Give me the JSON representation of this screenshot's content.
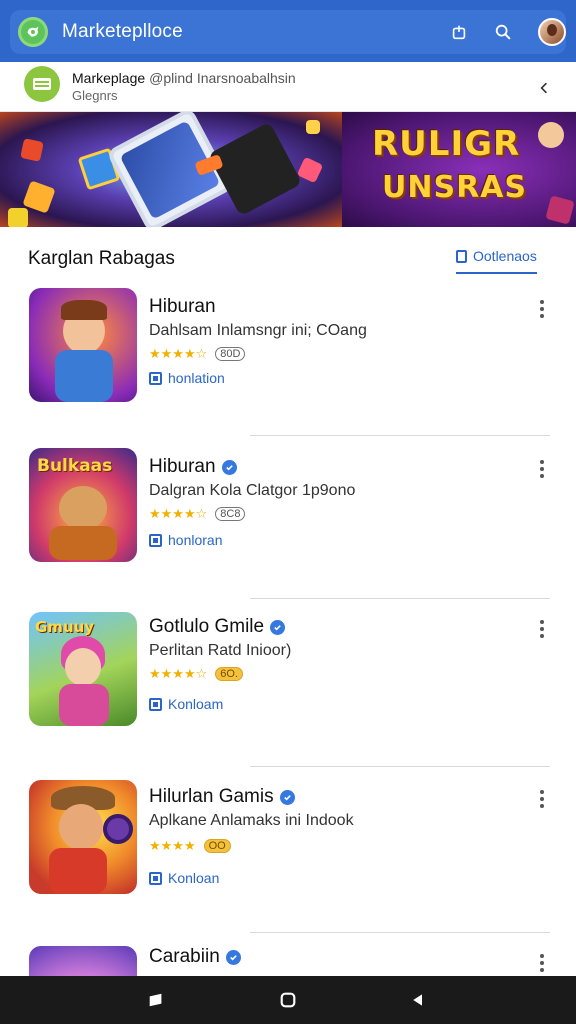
{
  "app_bar": {
    "title": "Marketeplloce",
    "icons": [
      "store-logo-icon",
      "share-icon",
      "search-icon",
      "user-avatar"
    ]
  },
  "header": {
    "title": "Markeplage",
    "title_extra": "@plind Inarsnoabalhsin",
    "subtitle": "Glegnrs"
  },
  "banner": {
    "headline_1": "RULIGR",
    "headline_2": "UNSRAS"
  },
  "section": {
    "title": "Karglan Rabagas",
    "link_label": "Ootlenaos"
  },
  "apps": [
    {
      "title": "Hiburan",
      "verified": false,
      "description": "Dahlsam Inlamsngr ini; COang",
      "stars": "★★★★☆",
      "rating_badge": "80D",
      "action_label": "honlation"
    },
    {
      "title": "Hiburan",
      "verified": true,
      "description": "Dalgran Kola Clatgor 1p9ono",
      "stars": "★★★★☆",
      "rating_badge": "8C8",
      "action_label": "honloran",
      "thumb_text": "Bulkaas"
    },
    {
      "title": "Gotlulo Gmile",
      "verified": true,
      "description": "Perlitan Ratd Inioor)",
      "stars": "★★★★☆",
      "rating_badge": "6O.",
      "action_label": "Konloam",
      "thumb_text": "Gmuuy"
    },
    {
      "title": "Hilurlan Gamis",
      "verified": true,
      "description": "Aplkane Anlamaks ini Indook",
      "stars": "★★★★",
      "rating_badge": "OO",
      "action_label": "Konloan"
    },
    {
      "title": "Carabiin",
      "verified": true,
      "description": "",
      "stars": "",
      "rating_badge": "",
      "action_label": ""
    }
  ],
  "colors": {
    "app_bar": "#2f66c9",
    "accent": "#2a66c8",
    "star": "#f0b100",
    "nav_bar": "#1a1a1a"
  },
  "navbar": {
    "icons": [
      "recents-icon",
      "home-icon",
      "back-icon"
    ]
  }
}
